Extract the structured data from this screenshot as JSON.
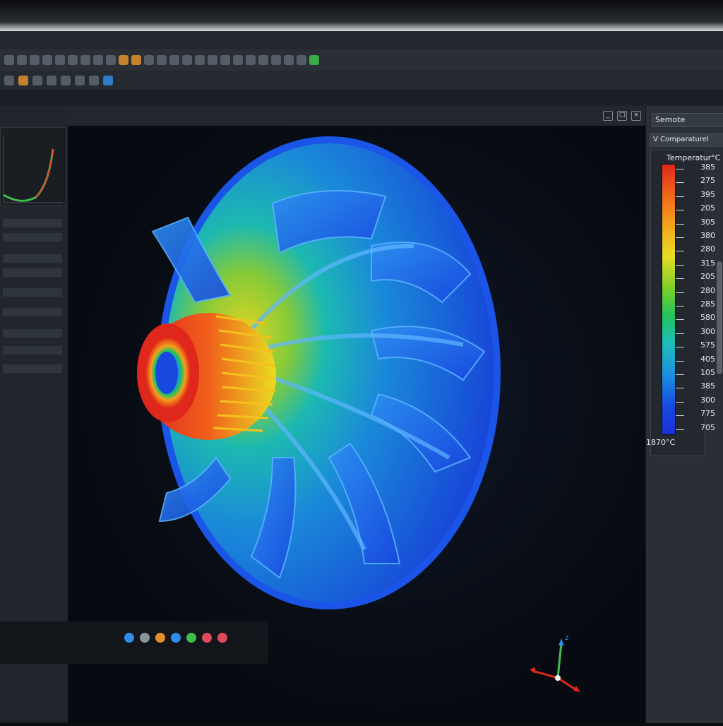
{
  "app": {
    "menu": [
      "",
      "",
      "",
      "",
      "",
      "",
      "",
      ""
    ],
    "viewport_tab_label": "",
    "viewport_overlay": "",
    "window_controls": [
      "_",
      "□",
      "×"
    ]
  },
  "right_panel": {
    "header": "Semote",
    "sub_header": "Comparaturel",
    "sub_header_glyph": "V",
    "legend": {
      "title": "Temperatur°C",
      "ticks": [
        "385",
        "275",
        "395",
        "205",
        "305",
        "380",
        "280",
        "315",
        "205",
        "280",
        "285",
        "580",
        "300",
        "575",
        "405",
        "105",
        "385",
        "300",
        "775",
        "705"
      ],
      "bottom_label": "1870°C"
    }
  },
  "colors": {
    "hot": "#e0271b",
    "mid": "#e9dd22",
    "cool": "#1b8fe0",
    "cold": "#1a2fd6",
    "accent_toolbar": "#e0902c"
  },
  "icons": {
    "triad": "xyz-axis-icon",
    "taskbar": [
      "app-icon-blue",
      "app-icon-gray",
      "app-icon-orange",
      "app-icon-blue",
      "app-icon-green",
      "app-icon-red",
      "app-icon-red"
    ]
  },
  "axes": {
    "z_label": "z"
  }
}
